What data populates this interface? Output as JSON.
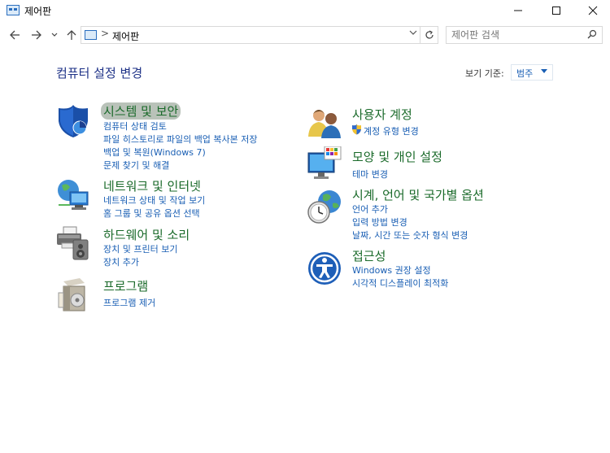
{
  "window": {
    "title": "제어판"
  },
  "address": {
    "path": "제어판",
    "separator": ">"
  },
  "search": {
    "placeholder": "제어판 검색"
  },
  "header": {
    "title": "컴퓨터 설정 변경",
    "view_label": "보기 기준:",
    "view_value": "범주"
  },
  "left_categories": [
    {
      "title": "시스템 및 보안",
      "icon": "shield-icon",
      "links": [
        "컴퓨터 상태 검토",
        "파일 히스토리로 파일의 백업 복사본 저장",
        "백업 및 복원(Windows 7)",
        "문제 찾기 및 해결"
      ]
    },
    {
      "title": "네트워크 및 인터넷",
      "icon": "globe-network-icon",
      "links": [
        "네트워크 상태 및 작업 보기",
        "홈 그룹 및 공유 옵션 선택"
      ]
    },
    {
      "title": "하드웨어 및 소리",
      "icon": "printer-speaker-icon",
      "links": [
        "장치 및 프린터 보기",
        "장치 추가"
      ]
    },
    {
      "title": "프로그램",
      "icon": "programs-box-icon",
      "links": [
        "프로그램 제거"
      ]
    }
  ],
  "right_categories": [
    {
      "title": "사용자 계정",
      "icon": "users-icon",
      "links": [
        "계정 유형 변경"
      ]
    },
    {
      "title": "모양 및 개인 설정",
      "icon": "monitor-palette-icon",
      "links": [
        "테마 변경"
      ]
    },
    {
      "title": "시계, 언어 및 국가별 옵션",
      "icon": "clock-globe-icon",
      "links": [
        "언어 추가",
        "입력 방법 변경",
        "날짜, 시간 또는 숫자 형식 변경"
      ]
    },
    {
      "title": "접근성",
      "icon": "accessibility-icon",
      "links": [
        "Windows 권장 설정",
        "시각적 디스플레이 최적화"
      ]
    }
  ]
}
